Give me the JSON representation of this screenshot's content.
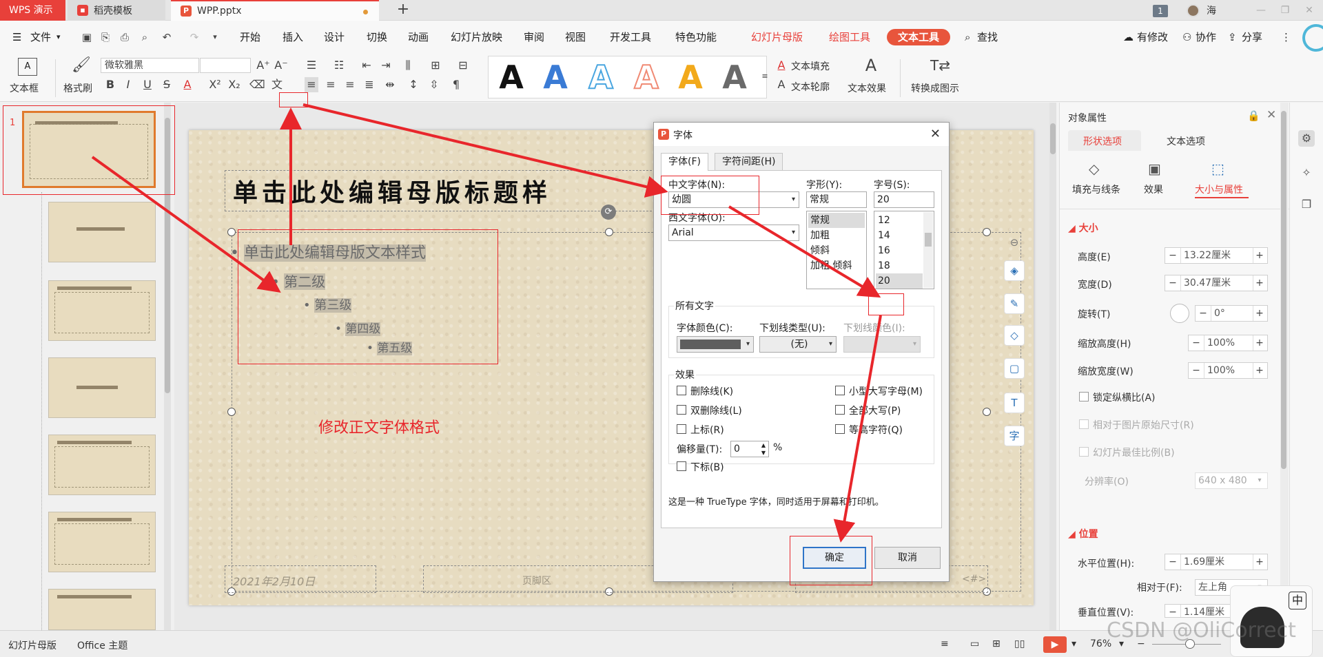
{
  "titlebar": {
    "app_name": "WPS 演示",
    "tabs": [
      {
        "label": "稻壳模板",
        "icon": "daoke-icon"
      },
      {
        "label": "WPP.pptx",
        "icon": "presentation-file-icon"
      }
    ],
    "window_count": "1",
    "user_name": "海"
  },
  "menu": {
    "file_label": "文件",
    "items": [
      "开始",
      "插入",
      "设计",
      "切换",
      "动画",
      "幻灯片放映",
      "审阅",
      "视图",
      "开发工具",
      "特色功能"
    ],
    "context_items": [
      "幻灯片母版",
      "绘图工具",
      "文本工具"
    ],
    "search_label": "查找",
    "right": {
      "changes": "有修改",
      "collab": "协作",
      "share": "分享"
    }
  },
  "ribbon": {
    "textbox_label": "文本框",
    "format_painter_label": "格式刷",
    "font_name": "微软雅黑",
    "font_size": "",
    "text_fill_label": "文本填充",
    "text_outline_label": "文本轮廓",
    "text_effect_label": "文本效果",
    "convert_label": "转换成图示",
    "style_samples": [
      "A",
      "A",
      "A",
      "A",
      "A",
      "A"
    ],
    "style_colors": [
      "#111111",
      "#3a7bd5",
      "#4aa6e0",
      "#f08a74",
      "#f2a91b",
      "#6a6a6a"
    ]
  },
  "thumbnails": {
    "first_index": "1",
    "count": 7
  },
  "slide": {
    "title": "单击此处编辑母版标题样",
    "bullets": [
      "单击此处编辑母版文本样式",
      "第二级",
      "第三级",
      "第四级",
      "第五级"
    ],
    "annotation": "修改正文字体格式",
    "footer_date": "2021年2月10日",
    "footer_center": "页脚区",
    "footer_num": "<#>"
  },
  "dialog": {
    "title": "字体",
    "tabs": [
      "字体(F)",
      "字符间距(H)"
    ],
    "cn_font_label": "中文字体(N):",
    "cn_font_value": "幼圆",
    "west_font_label": "西文字体(O):",
    "west_font_value": "Arial",
    "style_label": "字形(Y):",
    "style_value": "常规",
    "style_options": [
      "常规",
      "加粗",
      "倾斜",
      "加粗 倾斜"
    ],
    "size_label": "字号(S):",
    "size_value": "20",
    "size_options": [
      "12",
      "14",
      "16",
      "18",
      "20"
    ],
    "all_text_label": "所有文字",
    "color_label": "字体颜色(C):",
    "underline_type_label": "下划线类型(U):",
    "underline_type_value": "(无)",
    "underline_color_label": "下划线颜色(I):",
    "effects_label": "效果",
    "effects_left": [
      "删除线(K)",
      "双删除线(L)",
      "上标(R)"
    ],
    "effects_right": [
      "小型大写字母(M)",
      "全部大写(P)",
      "等高字符(Q)"
    ],
    "offset_label": "偏移量(T):",
    "offset_value": "0",
    "offset_unit": "%",
    "subscript_label": "下标(B)",
    "description": "这是一种 TrueType 字体，同时适用于屏幕和打印机。",
    "ok_label": "确定",
    "cancel_label": "取消"
  },
  "props": {
    "title": "对象属性",
    "tabs": [
      "形状选项",
      "文本选项"
    ],
    "subtabs": [
      "填充与线条",
      "效果",
      "大小与属性"
    ],
    "size_section": "大小",
    "height_label": "高度(E)",
    "height_value": "13.22厘米",
    "width_label": "宽度(D)",
    "width_value": "30.47厘米",
    "rotate_label": "旋转(T)",
    "rotate_value": "0°",
    "scale_h_label": "缩放高度(H)",
    "scale_h_value": "100%",
    "scale_w_label": "缩放宽度(W)",
    "scale_w_value": "100%",
    "lock_ratio_label": "锁定纵横比(A)",
    "relative_orig_label": "相对于图片原始尺寸(R)",
    "best_ratio_label": "幻灯片最佳比例(B)",
    "resolution_label": "分辨率(O)",
    "resolution_value": "640 x 480",
    "position_section": "位置",
    "h_pos_label": "水平位置(H):",
    "h_pos_value": "1.69厘米",
    "relative_label": "相对于(F):",
    "relative_value": "左上角",
    "v_pos_label": "垂直位置(V):",
    "v_pos_value": "1.14厘米"
  },
  "status": {
    "view_name": "幻灯片母版",
    "theme": "Office 主题",
    "zoom": "76%"
  },
  "sticker_char": "中",
  "watermark": "CSDN @OliCorrect"
}
